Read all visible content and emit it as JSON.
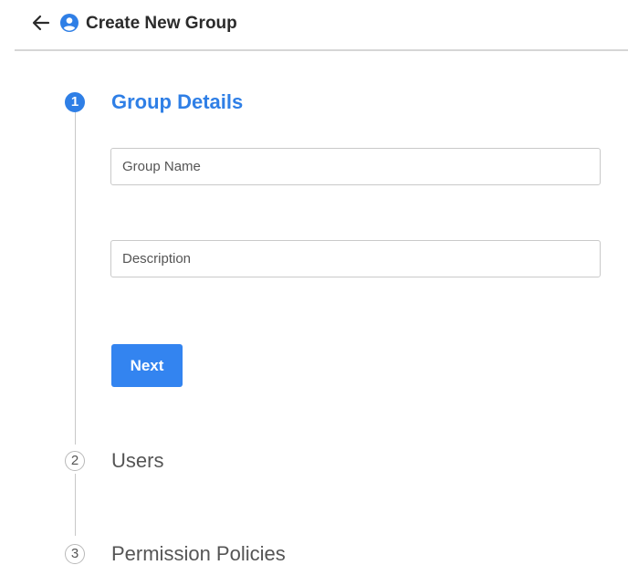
{
  "header": {
    "back_icon": "arrow-left-icon",
    "user_icon": "user-circle-icon",
    "title": "Create New Group"
  },
  "stepper": {
    "steps": [
      {
        "number": "1",
        "label": "Group Details",
        "state": "active"
      },
      {
        "number": "2",
        "label": "Users",
        "state": "inactive"
      },
      {
        "number": "3",
        "label": "Permission Policies",
        "state": "inactive"
      }
    ]
  },
  "form": {
    "group_name": {
      "placeholder": "Group Name",
      "value": ""
    },
    "description": {
      "placeholder": "Description",
      "value": ""
    },
    "next_label": "Next"
  },
  "colors": {
    "accent": "#2f7fe6",
    "button": "#3384f0",
    "divider": "#d6d6d6",
    "inactive_text": "#555555"
  }
}
